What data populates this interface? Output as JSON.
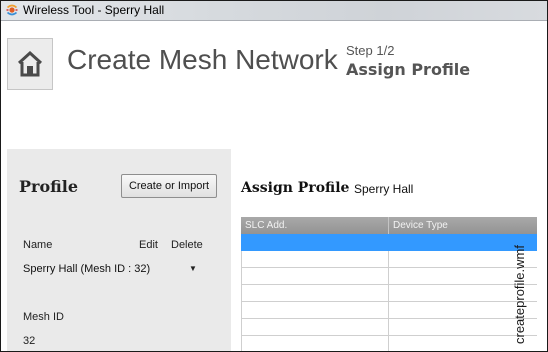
{
  "window": {
    "title": "Wireless Tool - Sperry Hall"
  },
  "header": {
    "home_icon": "home-icon",
    "title": "Create Mesh Network",
    "step_number": "Step 1/2",
    "step_name": "Assign Profile"
  },
  "profile_panel": {
    "heading": "Profile",
    "create_import_label": "Create or Import",
    "columns": {
      "name": "Name",
      "edit": "Edit",
      "delete": "Delete"
    },
    "selected_profile": "Sperry Hall (Mesh ID : 32)",
    "mesh_id_label": "Mesh ID",
    "mesh_id_value": "32"
  },
  "assign": {
    "label": "Assign Profile",
    "building": "Sperry Hall"
  },
  "grid": {
    "columns": [
      "SLC Add.",
      "Device Type"
    ],
    "selected_row_index": 0,
    "selection_color": "#3399ff"
  },
  "watermark": "createprofile.wmf"
}
